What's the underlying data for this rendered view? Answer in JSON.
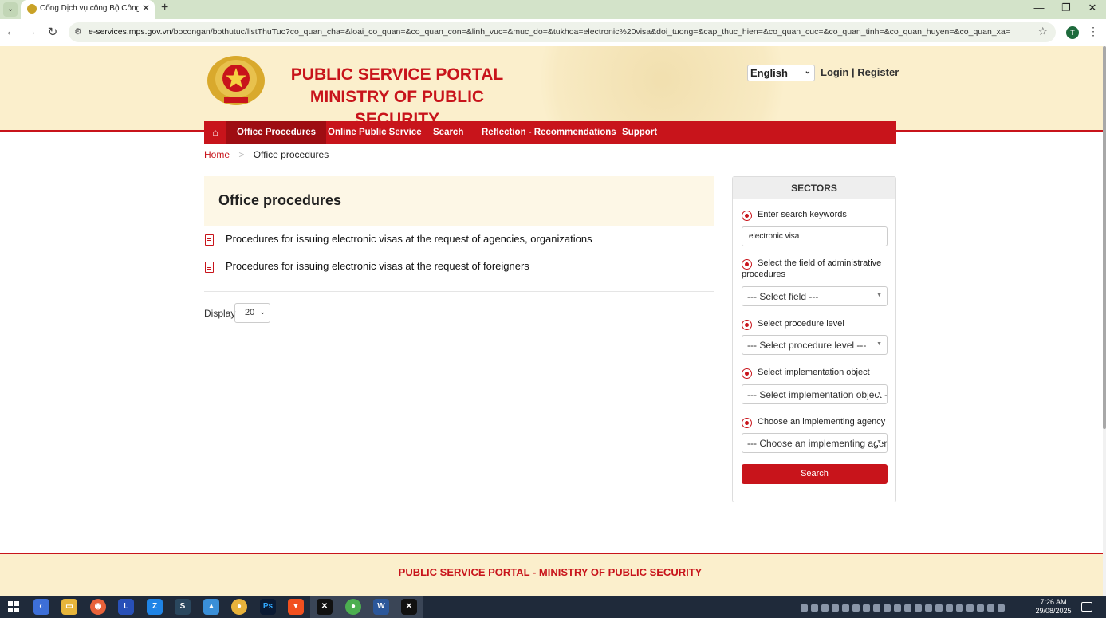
{
  "browser": {
    "tab_title": "Cổng Dịch vụ công Bộ Công an",
    "url_domain": "e-services.mps.gov.vn",
    "url_path": "/bocongan/bothutuc/listThuTuc?co_quan_cha=&loai_co_quan=&co_quan_con=&linh_vuc=&muc_do=&tukhoa=electronic%20visa&doi_tuong=&cap_thuc_hien=&co_quan_cuc=&co_quan_tinh=&co_quan_huyen=&co_quan_xa=",
    "profile_initial": "T",
    "icons": [
      "tab-search-icon",
      "close-icon",
      "plus-icon",
      "minimize-icon",
      "restore-icon",
      "back-icon",
      "forward-icon",
      "reload-icon",
      "site-settings-icon",
      "star-icon",
      "menu-icon"
    ]
  },
  "header": {
    "title_line1": "PUBLIC SERVICE PORTAL",
    "title_line2": "MINISTRY OF PUBLIC SECURITY",
    "language": "English",
    "auth": "Login | Register"
  },
  "nav": {
    "home_icon": "home-icon",
    "items": [
      {
        "label": "Office Procedures",
        "active": true
      },
      {
        "label": "Online Public Service",
        "active": false
      },
      {
        "label": "Search",
        "active": false
      },
      {
        "label": "Reflection - Recommendations",
        "active": false
      },
      {
        "label": "Support",
        "active": false
      }
    ]
  },
  "breadcrumb": {
    "home": "Home",
    "separator": ">",
    "current": "Office procedures"
  },
  "main": {
    "title": "Office procedures",
    "procedures": [
      "Procedures for issuing electronic visas at the request of agencies, organizations",
      "Procedures for issuing electronic visas at the request of foreigners"
    ],
    "display_label": "Display",
    "display_value": "20"
  },
  "sidebar": {
    "heading": "SECTORS",
    "keyword_label": "Enter search keywords",
    "keyword_value": "electronic visa",
    "field_label": "Select the field of administrative procedures",
    "field_value": "--- Select field ---",
    "level_label": "Select procedure level",
    "level_value": "--- Select procedure level ---",
    "object_label": "Select implementation object",
    "object_value": "--- Select implementation object ---",
    "agency_label": "Choose an implementing agency",
    "agency_value": "--- Choose an implementing agency ---",
    "search_button": "Search"
  },
  "footer": {
    "text": "PUBLIC SERVICE PORTAL - MINISTRY OF PUBLIC SECURITY"
  },
  "taskbar": {
    "time": "7:26 AM",
    "date": "29/08/2025",
    "apps": [
      "copilot",
      "file-explorer",
      "firefox",
      "L",
      "zalo",
      "steam",
      "app",
      "chrome",
      "photoshop",
      "brave",
      "capcut",
      "chrome-active",
      "word",
      "capcut-2"
    ]
  },
  "colors": {
    "brand_red": "#c8141b",
    "header_bg": "#fbefcc"
  }
}
